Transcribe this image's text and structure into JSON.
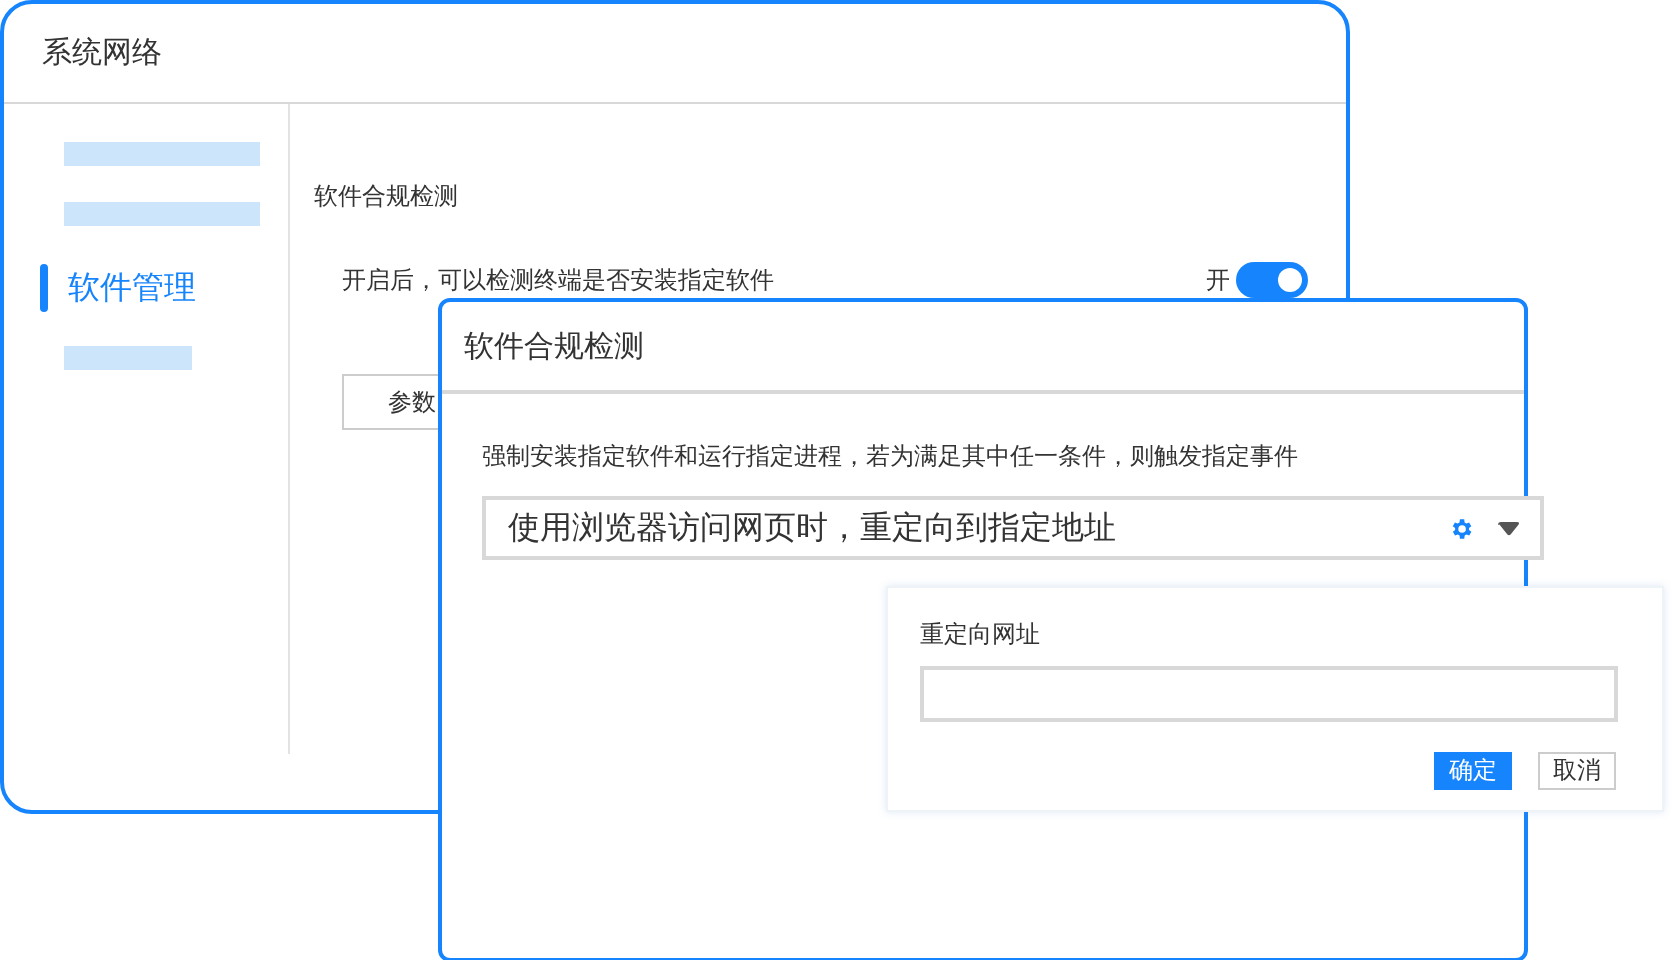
{
  "main_window": {
    "title": "系统网络",
    "sidebar": {
      "items": [
        {
          "kind": "placeholder",
          "selected": false
        },
        {
          "kind": "placeholder",
          "selected": false
        },
        {
          "kind": "text",
          "label": "软件管理",
          "selected": true
        },
        {
          "kind": "placeholder",
          "selected": false
        }
      ]
    },
    "section_title": "软件合规检测",
    "setting": {
      "description": "开启后，可以检测终端是否安装指定软件",
      "toggle_label": "开",
      "on": true
    },
    "params_button": "参数"
  },
  "dialog": {
    "title": "软件合规检测",
    "description": "强制安装指定软件和运行指定进程，若为满足其中任一条件，则触发指定事件",
    "action_select": {
      "value": "使用浏览器访问网页时，重定向到指定地址"
    }
  },
  "popover": {
    "label": "重定向网址",
    "buttons": [
      {
        "label": "确定",
        "kind": "primary"
      },
      {
        "label": "取消",
        "kind": "secondary"
      }
    ]
  }
}
